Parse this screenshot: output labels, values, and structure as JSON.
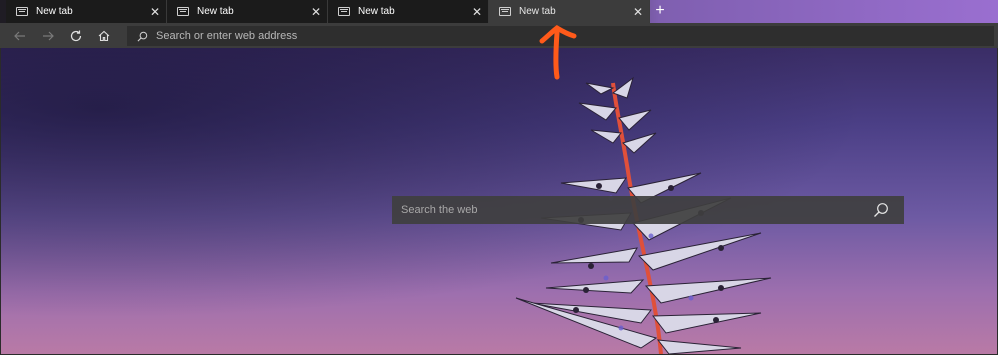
{
  "tabs": [
    {
      "title": "New tab",
      "close": "✕"
    },
    {
      "title": "New tab",
      "close": "✕"
    },
    {
      "title": "New tab",
      "close": "✕"
    },
    {
      "title": "New tab",
      "close": "✕"
    }
  ],
  "new_tab_button": "+",
  "toolbar": {
    "back_icon": "back-arrow-icon",
    "forward_icon": "forward-arrow-icon",
    "refresh_icon": "refresh-icon",
    "home_icon": "home-icon",
    "address_placeholder": "Search or enter web address"
  },
  "new_tab_page": {
    "search_placeholder": "Search the web"
  },
  "colors": {
    "annotation_arrow": "#ff5a1a",
    "tabstrip_accent": "#9a6fd0"
  }
}
